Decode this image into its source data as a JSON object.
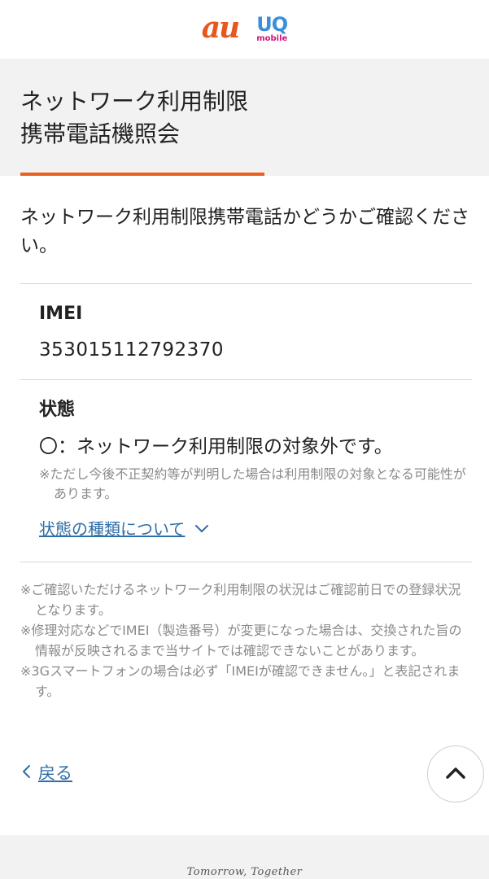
{
  "brand": {
    "au_logo": "au",
    "uq_logo_main": "UQ",
    "uq_logo_sub": "mobile",
    "au_color": "#e8571d",
    "uq_main_color": "#3a8fd8",
    "uq_sub_color": "#d1157a"
  },
  "colors": {
    "accent": "#e8611f",
    "link": "#2f6ea9",
    "footer_bg": "#f2f2f2"
  },
  "page": {
    "title_line1": "ネットワーク利用制限",
    "title_line2": "携帯電話機照会",
    "intro": "ネットワーク利用制限携帯電話かどうかご確認ください。"
  },
  "imei": {
    "label": "IMEI",
    "value": "353015112792370"
  },
  "status": {
    "label": "状態",
    "result": "〇：ネットワーク利用制限の対象外です。",
    "note": "※ただし今後不正契約等が判明した場合は利用制限の対象となる可能性があります。",
    "types_link": "状態の種類について",
    "types_link_icon": "chevron-down-icon"
  },
  "notes": [
    "※ご確認いただけるネットワーク利用制限の状況はご確認前日での登録状況となります。",
    "※修理対応などでIMEI（製造番号）が変更になった場合は、交換された旨の情報が反映されるまで当サイトでは確認できないことがあります。",
    "※3Gスマートフォンの場合は必ず「IMEIが確認できません。」と表記されます。"
  ],
  "navigation": {
    "back_label": "戻る",
    "back_icon": "chevron-left-icon",
    "to_top_icon": "chevron-up-icon"
  },
  "footer": {
    "slogan": "Tomorrow, Together"
  }
}
